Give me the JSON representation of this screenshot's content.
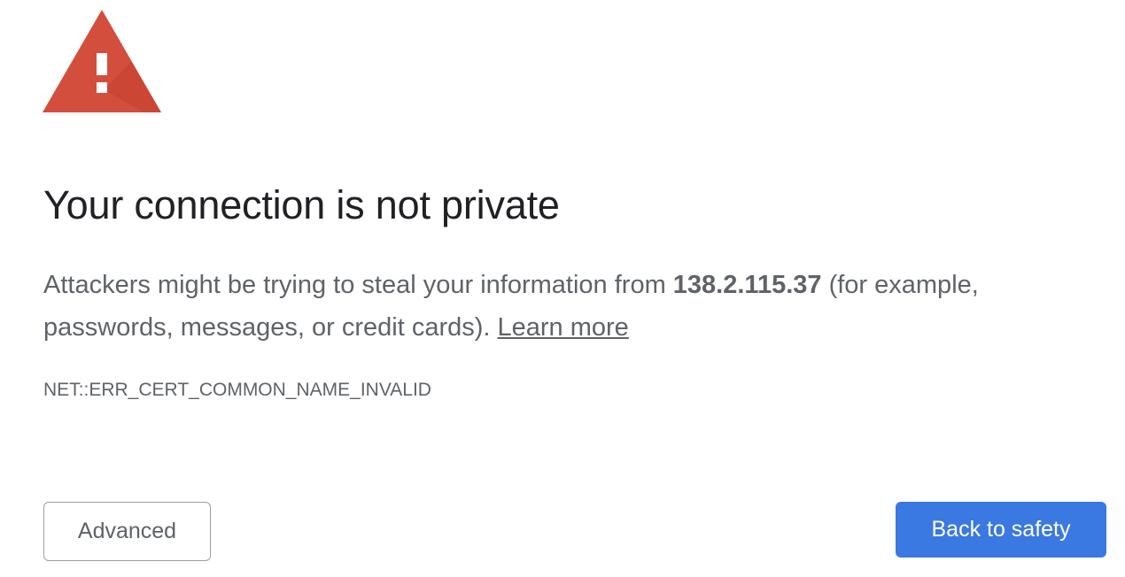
{
  "warning": {
    "icon": "warning-triangle-icon",
    "color": "#db4437"
  },
  "title": "Your connection is not private",
  "description": {
    "text_before": "Attackers might be trying to steal your information from ",
    "host": "138.2.115.37",
    "text_after": " (for example, passwords, messages, or credit cards). ",
    "learn_more": "Learn more"
  },
  "error_code": "NET::ERR_CERT_COMMON_NAME_INVALID",
  "buttons": {
    "advanced_label": "Advanced",
    "back_label": "Back to safety",
    "back_color": "#3a78e2"
  }
}
